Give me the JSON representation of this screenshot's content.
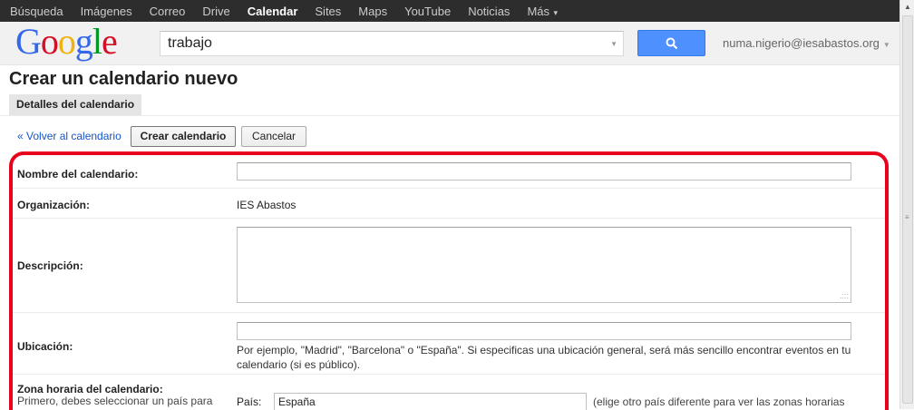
{
  "nav": {
    "items": [
      {
        "label": "Búsqueda"
      },
      {
        "label": "Imágenes"
      },
      {
        "label": "Correo"
      },
      {
        "label": "Drive"
      },
      {
        "label": "Calendar",
        "active": true
      },
      {
        "label": "Sites"
      },
      {
        "label": "Maps"
      },
      {
        "label": "YouTube"
      },
      {
        "label": "Noticias"
      }
    ],
    "more_label": "Más"
  },
  "logo": {
    "text": "Google"
  },
  "search": {
    "value": "trabajo",
    "button_icon": "search-icon"
  },
  "account": {
    "email": "numa.nigerio@iesabastos.org"
  },
  "page": {
    "title": "Crear un calendario nuevo",
    "tab_label": "Detalles del calendario"
  },
  "actions": {
    "back_label": "« Volver al calendario",
    "create_label": "Crear calendario",
    "cancel_label": "Cancelar"
  },
  "form": {
    "name_label": "Nombre del calendario:",
    "name_value": "",
    "org_label": "Organización:",
    "org_value": "IES Abastos",
    "desc_label": "Descripción:",
    "desc_value": "",
    "location_label": "Ubicación:",
    "location_value": "",
    "location_hint": "Por ejemplo, \"Madrid\", \"Barcelona\" o \"España\". Si especificas una ubicación general, será más sencillo encontrar eventos en tu calendario (si es público).",
    "tz_label": "Zona horaria del calendario:",
    "tz_sub": "Primero, debes seleccionar un país para",
    "tz_select_prefix": "País:",
    "tz_country": "España",
    "tz_after": "(elige otro país diferente para ver las zonas horarias"
  },
  "colors": {
    "accent": "#4d90fe",
    "highlight": "#e8001c",
    "link": "#1155cc"
  }
}
